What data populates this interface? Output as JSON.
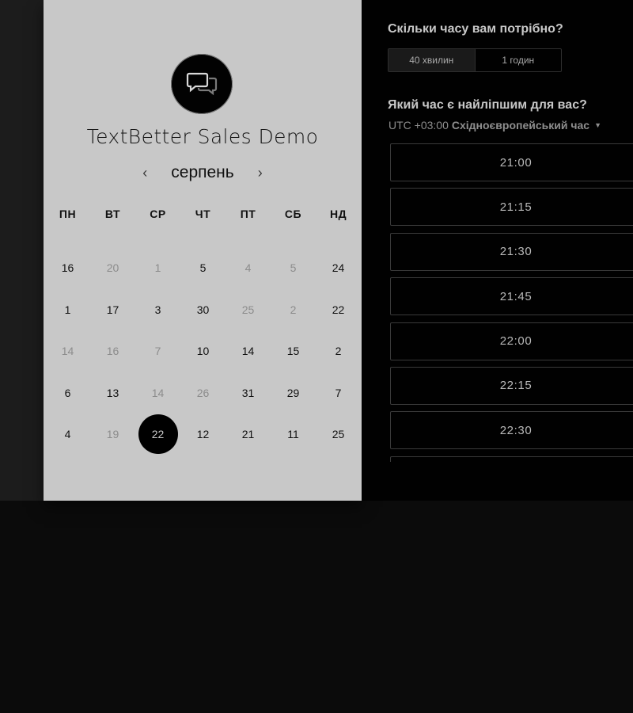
{
  "event": {
    "title": "TextBetter Sales Demo",
    "logo_icon": "chat-bubbles-icon"
  },
  "calendar": {
    "month": "серпень",
    "prev_icon": "‹",
    "next_icon": "›",
    "weekdays": [
      "ПН",
      "ВТ",
      "СР",
      "ЧТ",
      "ПТ",
      "СБ",
      "НД"
    ],
    "weeks": [
      [
        {
          "d": "16",
          "a": true
        },
        {
          "d": "20",
          "a": false
        },
        {
          "d": "1",
          "a": false
        },
        {
          "d": "5",
          "a": true
        },
        {
          "d": "4",
          "a": false
        },
        {
          "d": "5",
          "a": false
        },
        {
          "d": "24",
          "a": true
        }
      ],
      [
        {
          "d": "1",
          "a": true
        },
        {
          "d": "17",
          "a": true
        },
        {
          "d": "3",
          "a": true
        },
        {
          "d": "30",
          "a": true
        },
        {
          "d": "25",
          "a": false
        },
        {
          "d": "2",
          "a": false
        },
        {
          "d": "22",
          "a": true
        }
      ],
      [
        {
          "d": "14",
          "a": false
        },
        {
          "d": "16",
          "a": false
        },
        {
          "d": "7",
          "a": false
        },
        {
          "d": "10",
          "a": true
        },
        {
          "d": "14",
          "a": true
        },
        {
          "d": "15",
          "a": true
        },
        {
          "d": "2",
          "a": true
        }
      ],
      [
        {
          "d": "6",
          "a": true
        },
        {
          "d": "13",
          "a": true
        },
        {
          "d": "14",
          "a": false
        },
        {
          "d": "26",
          "a": false
        },
        {
          "d": "31",
          "a": true
        },
        {
          "d": "29",
          "a": true
        },
        {
          "d": "7",
          "a": true
        }
      ],
      [
        {
          "d": "4",
          "a": true
        },
        {
          "d": "19",
          "a": false
        },
        {
          "d": "22",
          "a": true,
          "selected": true
        },
        {
          "d": "12",
          "a": true
        },
        {
          "d": "21",
          "a": true
        },
        {
          "d": "11",
          "a": true
        },
        {
          "d": "25",
          "a": true
        }
      ]
    ]
  },
  "duration": {
    "heading": "Скільки часу вам потрібно?",
    "options": [
      "40 хвилин",
      "1 годин"
    ],
    "selected_index": 0
  },
  "timeslots": {
    "heading": "Який час є найліпшим для вас?",
    "tz_offset": "UTC +03:00",
    "tz_name": "Східноєвропейський час",
    "slots": [
      "21:00",
      "21:15",
      "21:30",
      "21:45",
      "22:00",
      "22:15",
      "22:30",
      ""
    ]
  }
}
